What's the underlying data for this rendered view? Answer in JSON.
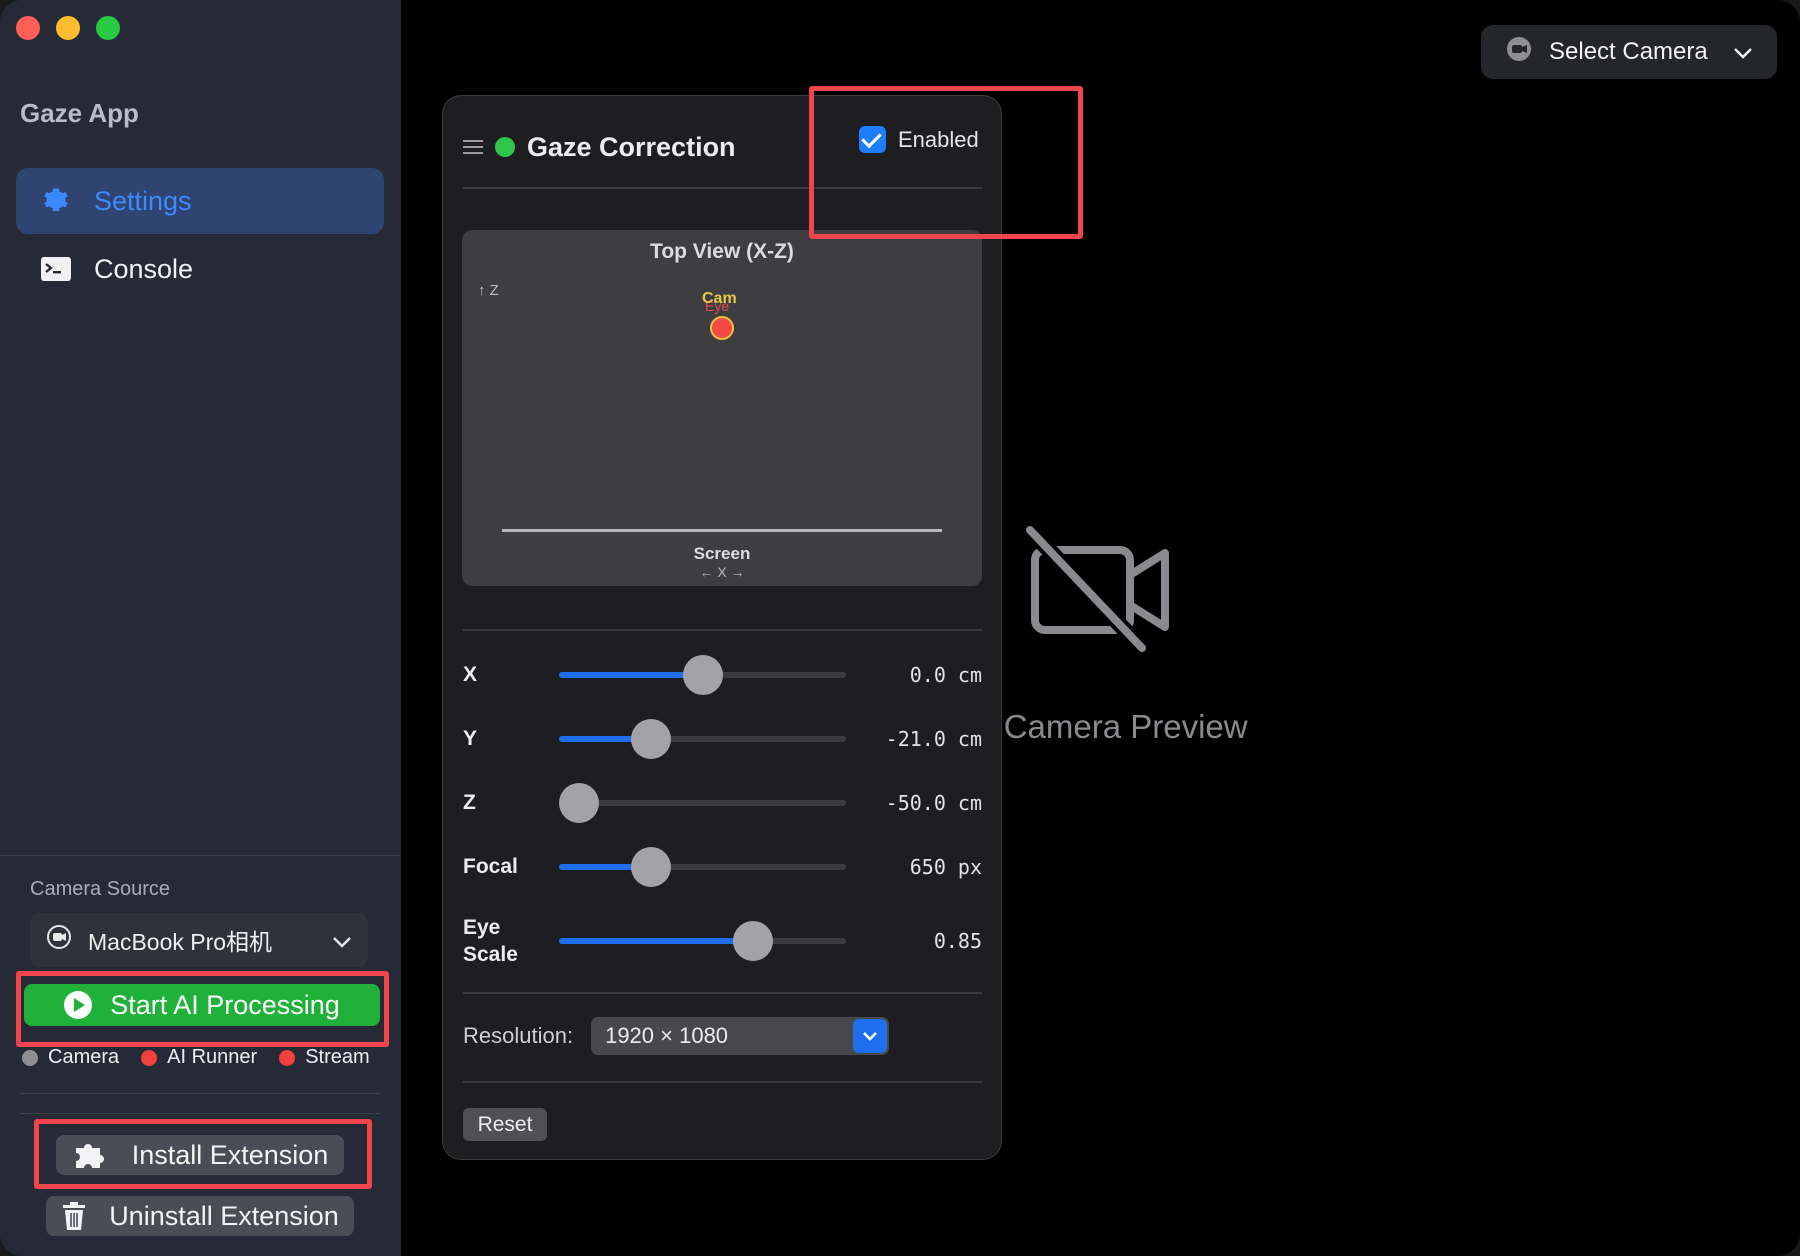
{
  "app": {
    "title": "Gaze App"
  },
  "sidebar": {
    "items": [
      {
        "label": "Settings",
        "icon": "gear-icon",
        "selected": true
      },
      {
        "label": "Console",
        "icon": "terminal-icon",
        "selected": false
      }
    ],
    "camera_source_label": "Camera Source",
    "camera_source_value": "MacBook Pro相机",
    "start_button": "Start AI Processing",
    "status": [
      {
        "label": "Camera",
        "color": "#8e8e93"
      },
      {
        "label": "AI Runner",
        "color": "#f2403c"
      },
      {
        "label": "Stream",
        "color": "#f2403c"
      }
    ],
    "install_button": "Install Extension",
    "uninstall_button": "Uninstall Extension"
  },
  "toolbar": {
    "select_camera": "Select Camera"
  },
  "preview": {
    "empty_text": "No Camera Preview"
  },
  "panel": {
    "title": "Gaze Correction",
    "enabled_label": "Enabled",
    "enabled": true,
    "top_view": {
      "title": "Top View (X-Z)",
      "z_axis": "↑ Z",
      "cam_label": "Cam",
      "eye_label": "Eye",
      "screen_label": "Screen",
      "x_axis": "← X →"
    },
    "sliders": [
      {
        "label": "X",
        "value": "0.0 cm",
        "fraction": 0.5
      },
      {
        "label": "Y",
        "value": "-21.0 cm",
        "fraction": 0.32
      },
      {
        "label": "Z",
        "value": "-50.0 cm",
        "fraction": 0.07
      },
      {
        "label": "Focal",
        "value": "650 px",
        "fraction": 0.32
      },
      {
        "label": "Eye\nScale",
        "value": "0.85",
        "fraction": 0.675
      }
    ],
    "resolution_label": "Resolution:",
    "resolution_value": "1920 × 1080",
    "reset_button": "Reset"
  },
  "colors": {
    "accent": "#1d7dfa",
    "success": "#1fb13a",
    "highlight": "#f0454d"
  }
}
